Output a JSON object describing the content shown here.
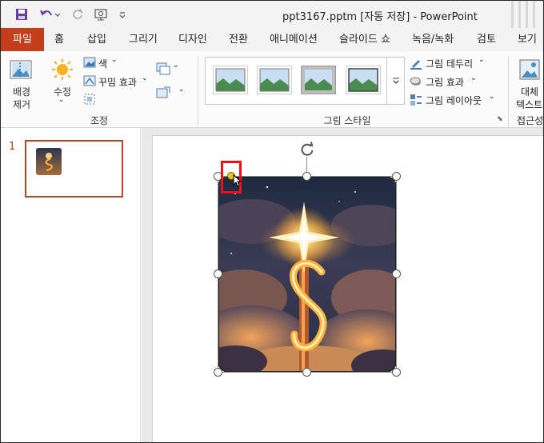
{
  "titlebar": {
    "title": "ppt3167.pptm [자동 저장]  -  PowerPoint",
    "icons": [
      "save-icon",
      "undo-icon",
      "redo-icon",
      "present-icon",
      "customize-icon"
    ]
  },
  "tabs": [
    {
      "label": "파일"
    },
    {
      "label": "홈"
    },
    {
      "label": "삽입"
    },
    {
      "label": "그리기"
    },
    {
      "label": "디자인"
    },
    {
      "label": "전환"
    },
    {
      "label": "애니메이션"
    },
    {
      "label": "슬라이드 쇼"
    },
    {
      "label": "녹음/녹화"
    },
    {
      "label": "검토"
    },
    {
      "label": "보기"
    }
  ],
  "ribbon": {
    "remove_bg": {
      "line1": "배경",
      "line2": "제거"
    },
    "corrections": "수정",
    "color": "색",
    "artistic": "꾸밈 효과",
    "group_adjust": "조정",
    "group_styles": "그림 스타일",
    "border": "그림 테두리",
    "effects": "그림 효과",
    "layout": "그림 레이아웃",
    "alt_text": {
      "line1": "대체",
      "line2": "텍스트"
    },
    "group_access": "접근성"
  },
  "slides": {
    "current_number": "1"
  },
  "colors": {
    "file_tab": "#c43e1c",
    "accent": "#b7472a",
    "highlight_box": "#e8141c",
    "adjust_handle": "#f2c21b"
  }
}
